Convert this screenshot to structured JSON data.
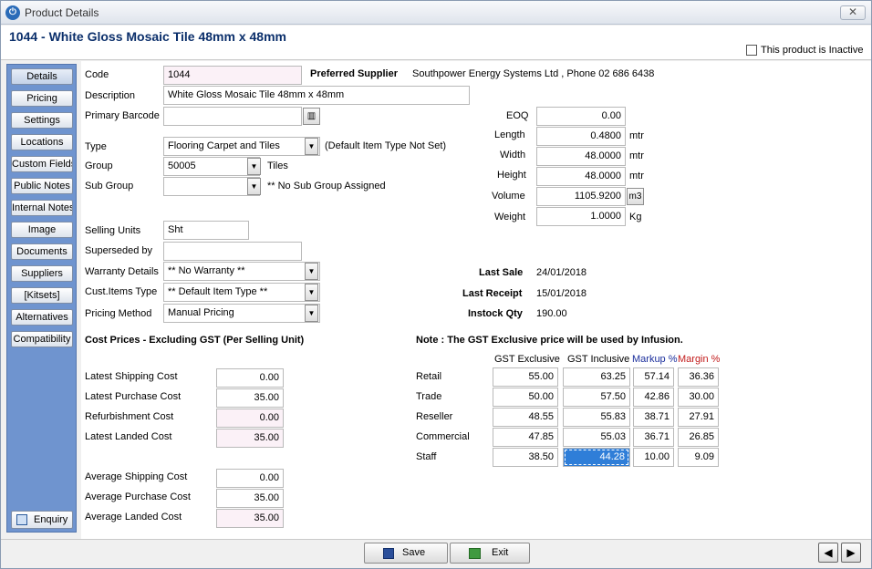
{
  "window": {
    "title": "Product Details",
    "close_glyph": "✕",
    "app_icon": "⏻"
  },
  "header": {
    "product_title": "1044 - White Gloss Mosaic Tile 48mm x 48mm",
    "inactive_label": "This product is Inactive",
    "inactive_checked": false
  },
  "sidebar": {
    "items": [
      {
        "label": "Details",
        "active": true
      },
      {
        "label": "Pricing"
      },
      {
        "label": "Settings"
      },
      {
        "label": "Locations"
      },
      {
        "label": "Custom Fields"
      },
      {
        "label": "Public Notes"
      },
      {
        "label": "Internal Notes"
      },
      {
        "label": "Image"
      },
      {
        "label": "Documents"
      },
      {
        "label": "Suppliers"
      },
      {
        "label": "[Kitsets]"
      },
      {
        "label": "Alternatives"
      },
      {
        "label": "Compatibility"
      }
    ],
    "enquiry_label": "Enquiry"
  },
  "form": {
    "code_label": "Code",
    "code_value": "1044",
    "description_label": "Description",
    "description_value": "White Gloss Mosaic Tile 48mm x 48mm",
    "barcode_label": "Primary Barcode",
    "barcode_value": "",
    "type_label": "Type",
    "type_value": "Flooring Carpet and Tiles",
    "type_note": "(Default Item Type Not Set)",
    "group_label": "Group",
    "group_value": "50005",
    "group_note": "Tiles",
    "subgroup_label": "Sub Group",
    "subgroup_value": "",
    "subgroup_note": "** No Sub Group Assigned",
    "selling_units_label": "Selling Units",
    "selling_units_value": "Sht",
    "superseded_label": "Superseded by",
    "superseded_value": "",
    "warranty_label": "Warranty Details",
    "warranty_value": "** No Warranty **",
    "cust_items_label": "Cust.Items Type",
    "cust_items_value": "** Default Item Type **",
    "pricing_method_label": "Pricing Method",
    "pricing_method_value": "Manual Pricing"
  },
  "supplier": {
    "label": "Preferred Supplier",
    "value": "Southpower Energy Systems Ltd , Phone 02 686 6438"
  },
  "dimensions": {
    "eoq_label": "EOQ",
    "eoq_value": "0.00",
    "length_label": "Length",
    "length_value": "0.4800",
    "length_unit": "mtr",
    "width_label": "Width",
    "width_value": "48.0000",
    "width_unit": "mtr",
    "height_label": "Height",
    "height_value": "48.0000",
    "height_unit": "mtr",
    "volume_label": "Volume",
    "volume_value": "1105.9200",
    "volume_unit": "m3",
    "weight_label": "Weight",
    "weight_value": "1.0000",
    "weight_unit": "Kg"
  },
  "sales": {
    "last_sale_label": "Last Sale",
    "last_sale_value": "24/01/2018",
    "last_receipt_label": "Last Receipt",
    "last_receipt_value": "15/01/2018",
    "instock_label": "Instock Qty",
    "instock_value": "190.00"
  },
  "cost": {
    "heading": "Cost Prices - Excluding GST (Per Selling Unit)",
    "latest_shipping_label": "Latest Shipping Cost",
    "latest_shipping_value": "0.00",
    "latest_purchase_label": "Latest Purchase Cost",
    "latest_purchase_value": "35.00",
    "refurb_label": "Refurbishment Cost",
    "refurb_value": "0.00",
    "latest_landed_label": "Latest Landed Cost",
    "latest_landed_value": "35.00",
    "avg_shipping_label": "Average Shipping Cost",
    "avg_shipping_value": "0.00",
    "avg_purchase_label": "Average Purchase Cost",
    "avg_purchase_value": "35.00",
    "avg_landed_label": "Average Landed Cost",
    "avg_landed_value": "35.00"
  },
  "pricing": {
    "note": "Note : The GST Exclusive price will be used by Infusion.",
    "headers": {
      "excl": "GST Exclusive",
      "incl": "GST Inclusive",
      "markup": "Markup %",
      "margin": "Margin %"
    },
    "rows": [
      {
        "name": "Retail",
        "excl": "55.00",
        "incl": "63.25",
        "markup": "57.14",
        "margin": "36.36"
      },
      {
        "name": "Trade",
        "excl": "50.00",
        "incl": "57.50",
        "markup": "42.86",
        "margin": "30.00"
      },
      {
        "name": "Reseller",
        "excl": "48.55",
        "incl": "55.83",
        "markup": "38.71",
        "margin": "27.91"
      },
      {
        "name": "Commercial",
        "excl": "47.85",
        "incl": "55.03",
        "markup": "36.71",
        "margin": "26.85"
      },
      {
        "name": "Staff",
        "excl": "38.50",
        "incl": "44.28",
        "markup": "10.00",
        "margin": "9.09"
      }
    ]
  },
  "footer": {
    "save_label": "Save",
    "exit_label": "Exit",
    "prev_glyph": "◀",
    "next_glyph": "▶"
  },
  "colors": {
    "sidebar": "#6f94cf",
    "title": "#0b2f6b",
    "selection": "#2f7ed8",
    "markup_header": "#1a2e9c",
    "margin_header": "#c21b1b"
  }
}
